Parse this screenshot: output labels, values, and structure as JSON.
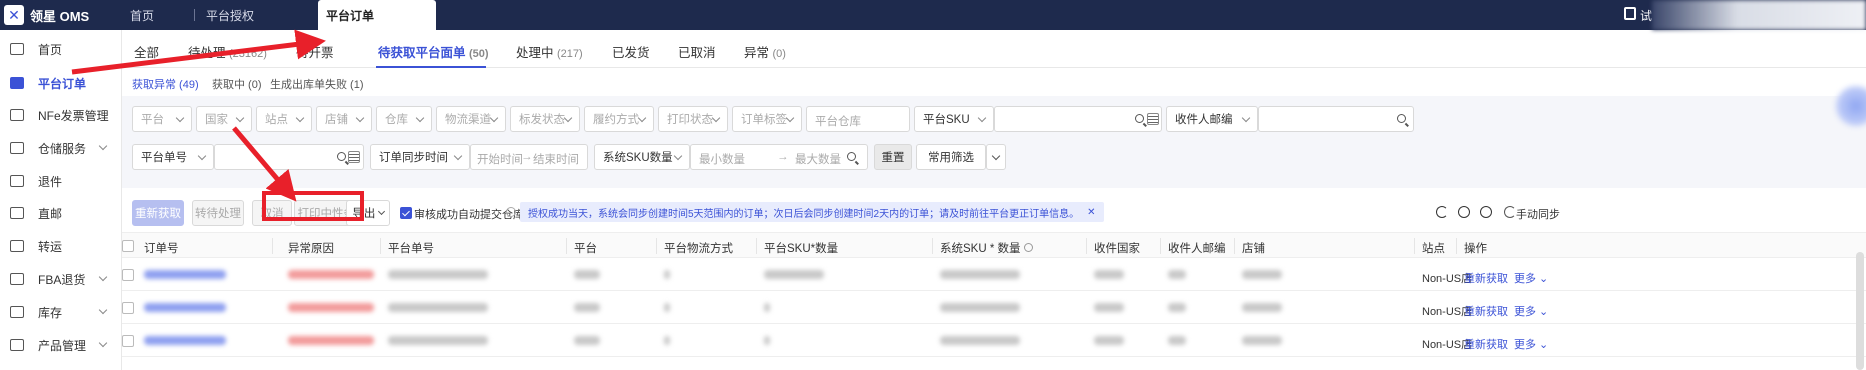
{
  "topbar": {
    "logo_text": "领星 OMS",
    "nav": [
      "首页",
      "平台授权",
      "平台订单"
    ],
    "right_text": "试"
  },
  "sidebar": {
    "items": [
      {
        "label": "首页",
        "icon": "home-icon"
      },
      {
        "label": "平台订单",
        "icon": "order-icon"
      },
      {
        "label": "NFe发票管理",
        "icon": "invoice-icon"
      },
      {
        "label": "仓储服务",
        "icon": "warehouse-icon"
      },
      {
        "label": "退件",
        "icon": "return-icon"
      },
      {
        "label": "直邮",
        "icon": "mail-icon"
      },
      {
        "label": "转运",
        "icon": "transfer-icon"
      },
      {
        "label": "FBA退货",
        "icon": "fba-icon"
      },
      {
        "label": "库存",
        "icon": "stock-icon"
      },
      {
        "label": "产品管理",
        "icon": "product-icon"
      }
    ]
  },
  "tabs": [
    {
      "label": "全部",
      "count": ""
    },
    {
      "label": "待处理",
      "count": "(23162)"
    },
    {
      "label": "待开票",
      "count": ""
    },
    {
      "label": "待获取平台面单",
      "count": "(50)"
    },
    {
      "label": "处理中",
      "count": "(217)"
    },
    {
      "label": "已发货",
      "count": ""
    },
    {
      "label": "已取消",
      "count": ""
    },
    {
      "label": "异常",
      "count": "(0)"
    }
  ],
  "subtabs": [
    "获取异常 (49)",
    "获取中 (0)",
    "生成出库单失败 (1)"
  ],
  "filters": {
    "row1": [
      "平台",
      "国家",
      "站点",
      "店铺",
      "仓库",
      "物流渠道",
      "标发状态",
      "履约方式",
      "打印状态",
      "订单标签"
    ],
    "platform_warehouse_placeholder": "平台仓库",
    "sku_select": "平台SKU",
    "email_select": "收件人邮编",
    "order_no_select": "平台单号",
    "sync_time_select": "订单同步时间",
    "start_time": "开始时间",
    "end_time": "结束时间",
    "range_arrow": "→",
    "sys_sku_select": "系统SKU数量",
    "min_qty": "最小数量",
    "max_qty": "最大数量",
    "reset": "重置",
    "common_filter": "常用筛选"
  },
  "toolbar": {
    "refetch": "重新获取",
    "to_pending": "转待处理",
    "cancel": "取消",
    "print": "打印中性条码",
    "export": "导出",
    "auto_submit": "审核成功自动提交仓库",
    "notice": "授权成功当天，系统会同步创建时间5天范围内的订单；次日后会同步创建时间2天内的订单；请及时前往平台更正订单信息。",
    "manual_sync": "手动同步"
  },
  "table": {
    "headers": [
      "订单号",
      "异常原因",
      "平台单号",
      "平台",
      "平台物流方式",
      "平台SKU*数量",
      "系统SKU * 数量",
      "收件国家",
      "收件人邮编",
      "店铺",
      "站点",
      "操作"
    ],
    "rows": [
      {
        "site": "Non-US店",
        "refetch": "重新获取",
        "more": "更多"
      },
      {
        "site": "Non-US店",
        "refetch": "重新获取",
        "more": "更多"
      },
      {
        "site": "Non-US店",
        "refetch": "重新获取",
        "more": "更多"
      }
    ]
  },
  "colors": {
    "accent": "#3b52d6",
    "topbar": "#1e2a4d",
    "annotation": "#e8202a"
  }
}
